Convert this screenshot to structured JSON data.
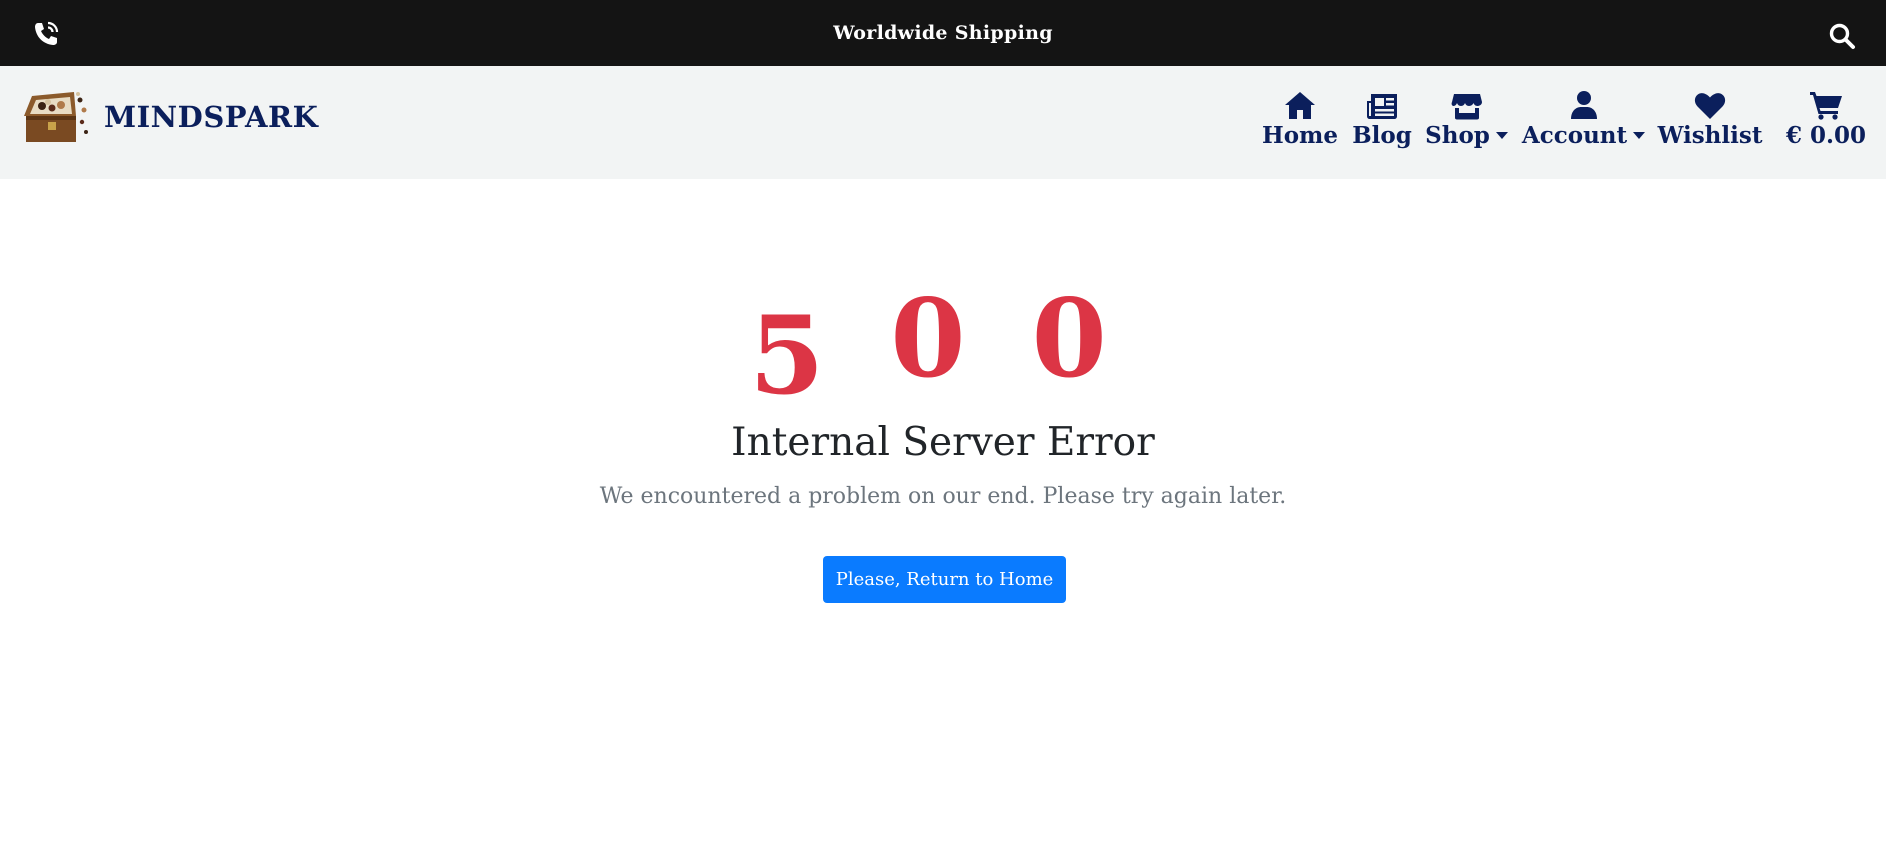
{
  "topbar": {
    "shipping_text": "Worldwide Shipping",
    "phone_icon": "phone-icon",
    "search_icon": "search-icon"
  },
  "brand": {
    "name": "MINDSPARK",
    "logo_icon": "treasure-chest-logo"
  },
  "nav": {
    "items": [
      {
        "label": "Home",
        "icon": "home-icon"
      },
      {
        "label": "Blog",
        "icon": "newspaper-icon"
      },
      {
        "label": "Shop",
        "icon": "store-icon",
        "dropdown": true
      },
      {
        "label": "Account",
        "icon": "user-icon",
        "dropdown": true
      },
      {
        "label": "Wishlist",
        "icon": "heart-icon"
      },
      {
        "label": "€ 0.00",
        "icon": "cart-icon"
      }
    ]
  },
  "error": {
    "digits": [
      "5",
      "0",
      "0"
    ],
    "title": "Internal Server Error",
    "message": "We encountered a problem on our end. Please try again later.",
    "button_label": "Please, Return to Home"
  },
  "colors": {
    "topbar_bg": "#141414",
    "header_bg": "#f2f4f4",
    "brand_navy": "#0b1f5c",
    "error_red": "#dc3545",
    "button_blue": "#0a7bff"
  }
}
